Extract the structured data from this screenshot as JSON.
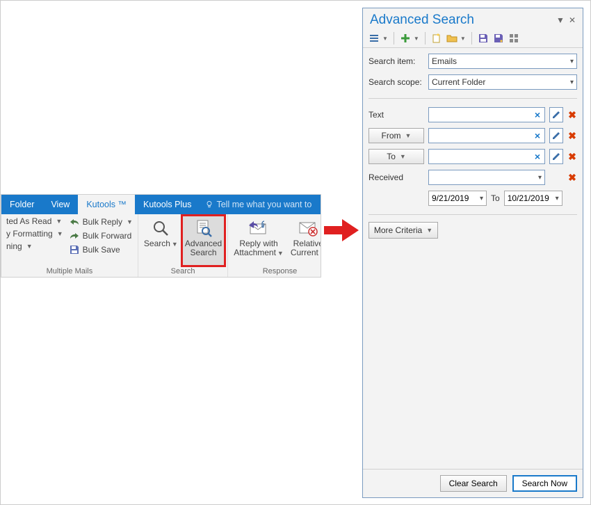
{
  "ribbon": {
    "tabs": {
      "folder": "Folder",
      "view": "View",
      "kutools": "Kutools ™",
      "kutools_plus": "Kutools Plus"
    },
    "tellme": "Tell me what you want to",
    "group_multiple": {
      "label": "Multiple Mails",
      "items": {
        "as_read": "ted As Read",
        "formatting": "y Formatting",
        "ning": "ning",
        "bulk_reply": "Bulk Reply",
        "bulk_forward": "Bulk Forward",
        "bulk_save": "Bulk Save"
      }
    },
    "group_search": {
      "label": "Search",
      "search_btn": "Search",
      "adv_line1": "Advanced",
      "adv_line2": "Search"
    },
    "group_response": {
      "label": "Response",
      "reply_line1": "Reply with",
      "reply_line2": "Attachment",
      "relative_line1": "Relative",
      "relative_line2": "Current"
    }
  },
  "panel": {
    "title": "Advanced Search",
    "search_item_label": "Search item:",
    "search_item_value": "Emails",
    "search_scope_label": "Search scope:",
    "search_scope_value": "Current Folder",
    "text_label": "Text",
    "from_label": "From",
    "to_label": "To",
    "received_label": "Received",
    "date_from": "9/21/2019",
    "date_to_label": "To",
    "date_to": "10/21/2019",
    "more_criteria": "More Criteria",
    "clear_search": "Clear Search",
    "search_now": "Search Now"
  }
}
